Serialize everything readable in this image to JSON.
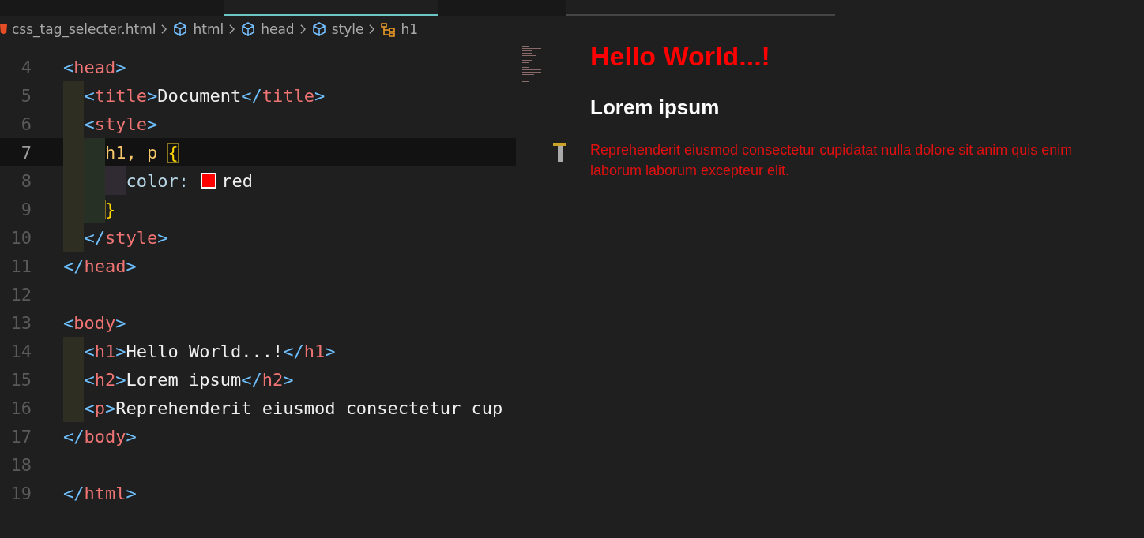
{
  "breadcrumb": [
    {
      "kind": "file",
      "label": "css_tag_selecter.html"
    },
    {
      "kind": "element",
      "label": "html"
    },
    {
      "kind": "element",
      "label": "head"
    },
    {
      "kind": "element",
      "label": "style"
    },
    {
      "kind": "selector",
      "label": "h1"
    }
  ],
  "code_lines": [
    {
      "number": "4",
      "current": false,
      "tokens": [
        {
          "kind": "punct",
          "text": "<"
        },
        {
          "kind": "tag",
          "text": "head"
        },
        {
          "kind": "punct",
          "text": ">"
        }
      ]
    },
    {
      "number": "5",
      "current": false,
      "tokens": [
        {
          "kind": "indent"
        },
        {
          "kind": "punct",
          "text": "<"
        },
        {
          "kind": "tag",
          "text": "title"
        },
        {
          "kind": "punct",
          "text": ">"
        },
        {
          "kind": "text",
          "text": "Document"
        },
        {
          "kind": "punct",
          "text": "</"
        },
        {
          "kind": "tag",
          "text": "title"
        },
        {
          "kind": "punct",
          "text": ">"
        }
      ]
    },
    {
      "number": "6",
      "current": false,
      "tokens": [
        {
          "kind": "indent"
        },
        {
          "kind": "punct",
          "text": "<"
        },
        {
          "kind": "tag",
          "text": "style"
        },
        {
          "kind": "punct",
          "text": ">"
        }
      ]
    },
    {
      "number": "7",
      "current": true,
      "tokens": [
        {
          "kind": "indent"
        },
        {
          "kind": "indent2"
        },
        {
          "kind": "selector",
          "text": "h1, p "
        },
        {
          "kind": "brace",
          "text": "{"
        }
      ]
    },
    {
      "number": "8",
      "current": false,
      "tokens": [
        {
          "kind": "indent"
        },
        {
          "kind": "indent2"
        },
        {
          "kind": "indent3"
        },
        {
          "kind": "prop",
          "text": "color: "
        },
        {
          "kind": "swatch",
          "color": "#ff0000"
        },
        {
          "kind": "text",
          "text": "red"
        }
      ]
    },
    {
      "number": "9",
      "current": false,
      "tokens": [
        {
          "kind": "indent"
        },
        {
          "kind": "indent2"
        },
        {
          "kind": "brace",
          "text": "}"
        }
      ]
    },
    {
      "number": "10",
      "current": false,
      "tokens": [
        {
          "kind": "indent"
        },
        {
          "kind": "punct",
          "text": "</"
        },
        {
          "kind": "tag",
          "text": "style"
        },
        {
          "kind": "punct",
          "text": ">"
        }
      ]
    },
    {
      "number": "11",
      "current": false,
      "tokens": [
        {
          "kind": "punct",
          "text": "</"
        },
        {
          "kind": "tag",
          "text": "head"
        },
        {
          "kind": "punct",
          "text": ">"
        }
      ]
    },
    {
      "number": "12",
      "current": false
    },
    {
      "number": "13",
      "current": false,
      "tokens": [
        {
          "kind": "punct",
          "text": "<"
        },
        {
          "kind": "tag",
          "text": "body"
        },
        {
          "kind": "punct",
          "text": ">"
        }
      ]
    },
    {
      "number": "14",
      "current": false,
      "tokens": [
        {
          "kind": "indent"
        },
        {
          "kind": "punct",
          "text": "<"
        },
        {
          "kind": "tag",
          "text": "h1"
        },
        {
          "kind": "punct",
          "text": ">"
        },
        {
          "kind": "text",
          "text": "Hello World...!"
        },
        {
          "kind": "punct",
          "text": "</"
        },
        {
          "kind": "tag",
          "text": "h1"
        },
        {
          "kind": "punct",
          "text": ">"
        }
      ]
    },
    {
      "number": "15",
      "current": false,
      "tokens": [
        {
          "kind": "indent"
        },
        {
          "kind": "punct",
          "text": "<"
        },
        {
          "kind": "tag",
          "text": "h2"
        },
        {
          "kind": "punct",
          "text": ">"
        },
        {
          "kind": "text",
          "text": "Lorem ipsum"
        },
        {
          "kind": "punct",
          "text": "</"
        },
        {
          "kind": "tag",
          "text": "h2"
        },
        {
          "kind": "punct",
          "text": ">"
        }
      ]
    },
    {
      "number": "16",
      "current": false,
      "tokens": [
        {
          "kind": "indent"
        },
        {
          "kind": "punct",
          "text": "<"
        },
        {
          "kind": "tag",
          "text": "p"
        },
        {
          "kind": "punct",
          "text": ">"
        },
        {
          "kind": "text",
          "text": "Reprehenderit eiusmod consectetur cup"
        }
      ]
    },
    {
      "number": "17",
      "current": false,
      "tokens": [
        {
          "kind": "punct",
          "text": "</"
        },
        {
          "kind": "tag",
          "text": "body"
        },
        {
          "kind": "punct",
          "text": ">"
        }
      ]
    },
    {
      "number": "18",
      "current": false
    },
    {
      "number": "19",
      "current": false,
      "tokens": [
        {
          "kind": "punct",
          "text": "</"
        },
        {
          "kind": "tag",
          "text": "html"
        },
        {
          "kind": "punct",
          "text": ">"
        }
      ]
    }
  ],
  "preview": {
    "heading_1": "Hello World...!",
    "heading_2": "Lorem ipsum",
    "paragraph": "Reprehenderit eiusmod consectetur cupidatat nulla dolore sit anim quis enim laborum laborum excepteur elit."
  }
}
